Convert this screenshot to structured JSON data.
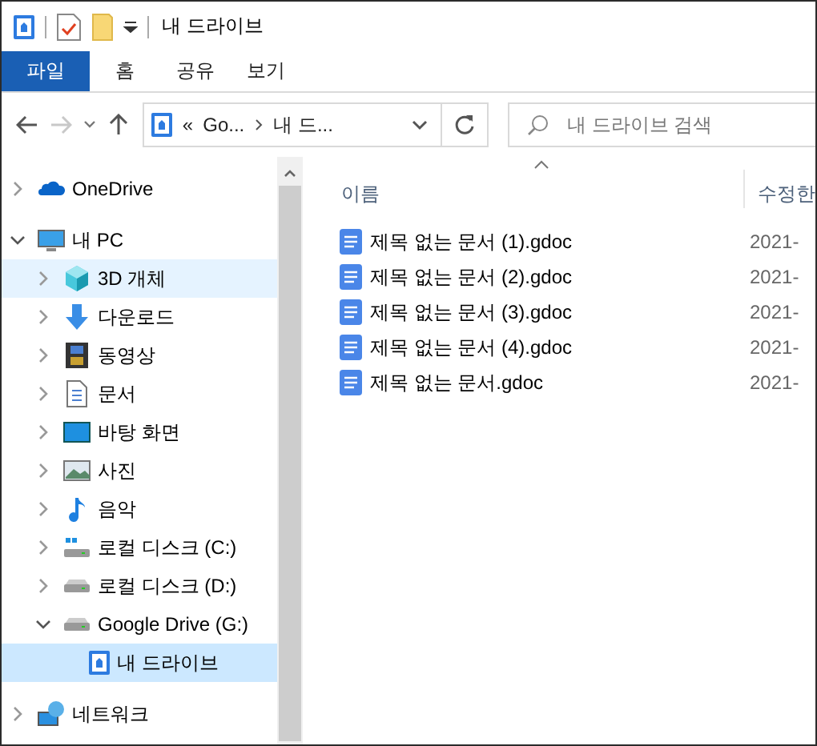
{
  "window": {
    "title": "내 드라이브"
  },
  "ribbon_tabs": [
    {
      "label": "파일",
      "selected": true
    },
    {
      "label": "홈",
      "selected": false
    },
    {
      "label": "공유",
      "selected": false
    },
    {
      "label": "보기",
      "selected": false
    }
  ],
  "address": {
    "overflow": "«",
    "segments": [
      "Go...",
      "내 드..."
    ]
  },
  "search": {
    "placeholder": "내 드라이브 검색"
  },
  "sidebar": {
    "items": [
      {
        "label": "OneDrive",
        "kind": "cloud",
        "expanded": false,
        "selected": false,
        "hovered": false
      },
      {
        "label": "내 PC",
        "kind": "pc",
        "expanded": true,
        "selected": false,
        "hovered": false,
        "children": [
          {
            "label": "3D 개체",
            "kind": "cube",
            "expanded": false,
            "selected": false,
            "hovered": true
          },
          {
            "label": "다운로드",
            "kind": "download",
            "expanded": false,
            "selected": false,
            "hovered": false
          },
          {
            "label": "동영상",
            "kind": "film",
            "expanded": false,
            "selected": false,
            "hovered": false
          },
          {
            "label": "문서",
            "kind": "document",
            "expanded": false,
            "selected": false,
            "hovered": false
          },
          {
            "label": "바탕 화면",
            "kind": "desktop",
            "expanded": false,
            "selected": false,
            "hovered": false
          },
          {
            "label": "사진",
            "kind": "photo",
            "expanded": false,
            "selected": false,
            "hovered": false
          },
          {
            "label": "음악",
            "kind": "music",
            "expanded": false,
            "selected": false,
            "hovered": false
          },
          {
            "label": "로컬 디스크 (C:)",
            "kind": "systemdrive",
            "expanded": false,
            "selected": false,
            "hovered": false
          },
          {
            "label": "로컬 디스크 (D:)",
            "kind": "drive",
            "expanded": false,
            "selected": false,
            "hovered": false
          },
          {
            "label": "Google Drive (G:)",
            "kind": "drive",
            "expanded": true,
            "selected": false,
            "hovered": false,
            "children": [
              {
                "label": "내 드라이브",
                "kind": "gdrive",
                "selected": true,
                "hovered": false
              }
            ]
          }
        ]
      },
      {
        "label": "네트워크",
        "kind": "network",
        "expanded": false,
        "selected": false,
        "hovered": false
      }
    ]
  },
  "table": {
    "columns": [
      "이름",
      "수정한"
    ],
    "rows": [
      {
        "name": "제목 없는 문서 (1).gdoc",
        "column_2": "2021-"
      },
      {
        "name": "제목 없는 문서 (2).gdoc",
        "column_2": "2021-"
      },
      {
        "name": "제목 없는 문서 (3).gdoc",
        "column_2": "2021-"
      },
      {
        "name": "제목 없는 문서 (4).gdoc",
        "column_2": "2021-"
      },
      {
        "name": "제목 없는 문서.gdoc",
        "column_2": "2021-"
      }
    ]
  }
}
